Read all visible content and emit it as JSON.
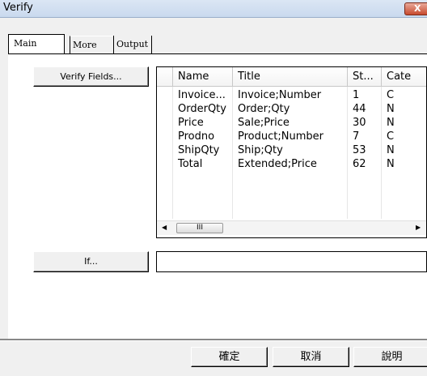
{
  "window": {
    "title": "Verify",
    "close_glyph": "X"
  },
  "tabs": [
    "Main",
    "More",
    "Output"
  ],
  "main": {
    "verify_fields_label": "Verify Fields...",
    "if_label": "If...",
    "if_value": "",
    "columns": [
      "Name",
      "Title",
      "St...",
      "Cate"
    ],
    "rows": [
      [
        "Invoice...",
        "Invoice;Number",
        "1",
        "C"
      ],
      [
        "OrderQty",
        "Order;Qty",
        "44",
        "N"
      ],
      [
        "Price",
        "Sale;Price",
        "30",
        "N"
      ],
      [
        "Prodno",
        "Product;Number",
        "7",
        "C"
      ],
      [
        "ShipQty",
        "Ship;Qty",
        "53",
        "N"
      ],
      [
        "Total",
        "Extended;Price",
        "62",
        "N"
      ]
    ],
    "scrollbar_thumb_glyph": "III"
  },
  "buttons": {
    "ok": "確定",
    "cancel": "取消",
    "help": "說明"
  }
}
